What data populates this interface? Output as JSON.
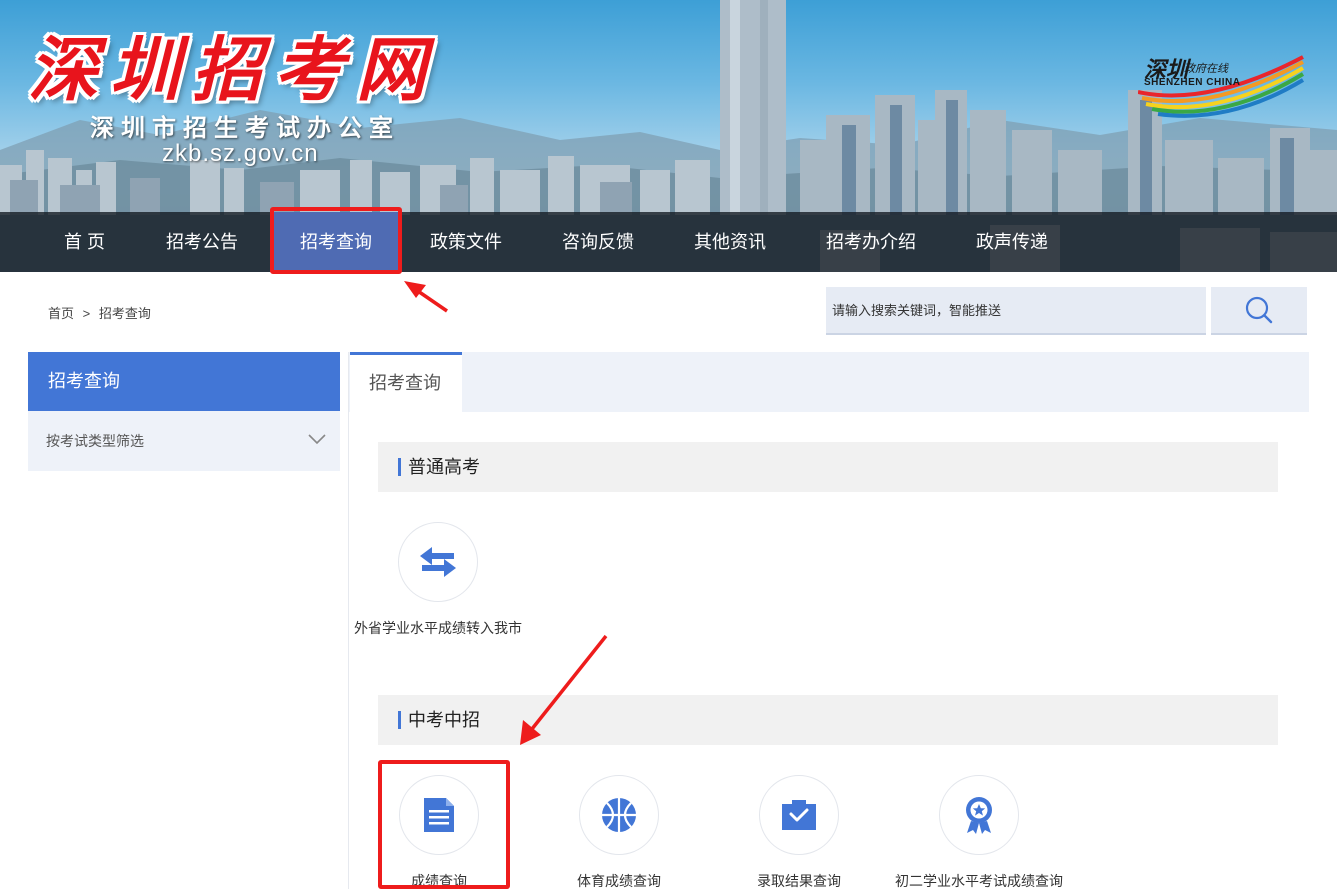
{
  "header": {
    "site_title": "深圳招考网",
    "site_subtitle": "深圳市招生考试办公室",
    "site_domain": "zkb.sz.gov.cn",
    "logo": {
      "name_cn": "深圳",
      "tagline_cn": "政府在线",
      "name_en": "SHENZHEN CHINA"
    }
  },
  "nav": {
    "items": [
      {
        "label": "首 页"
      },
      {
        "label": "招考公告"
      },
      {
        "label": "招考查询",
        "active": true
      },
      {
        "label": "政策文件"
      },
      {
        "label": "咨询反馈"
      },
      {
        "label": "其他资讯"
      },
      {
        "label": "招考办介绍"
      },
      {
        "label": "政声传递"
      }
    ]
  },
  "breadcrumb": {
    "home": "首页",
    "separator": ">",
    "current": "招考查询"
  },
  "search": {
    "placeholder": "请输入搜索关键词，智能推送",
    "icon": "search-icon"
  },
  "sidebar": {
    "title": "招考查询",
    "filter_label": "按考试类型筛选",
    "filter_icon": "chevron-down-icon"
  },
  "main": {
    "tab_label": "招考查询",
    "sections": [
      {
        "title": "普通高考",
        "items": [
          {
            "label": "外省学业水平成绩转入我市",
            "icon": "transfer-arrows-icon"
          }
        ]
      },
      {
        "title": "中考中招",
        "items": [
          {
            "label": "成绩查询",
            "icon": "document-icon"
          },
          {
            "label": "体育成绩查询",
            "icon": "basketball-icon"
          },
          {
            "label": "录取结果查询",
            "icon": "inbox-check-icon"
          },
          {
            "label": "初二学业水平考试成绩查询",
            "icon": "medal-star-icon"
          }
        ]
      }
    ]
  },
  "colors": {
    "brand_blue": "#4276d6",
    "nav_active": "#4f6bb3",
    "title_red": "#e8141c",
    "annotation_red": "#ee1c1c",
    "panel_bg": "#eef2f9"
  }
}
